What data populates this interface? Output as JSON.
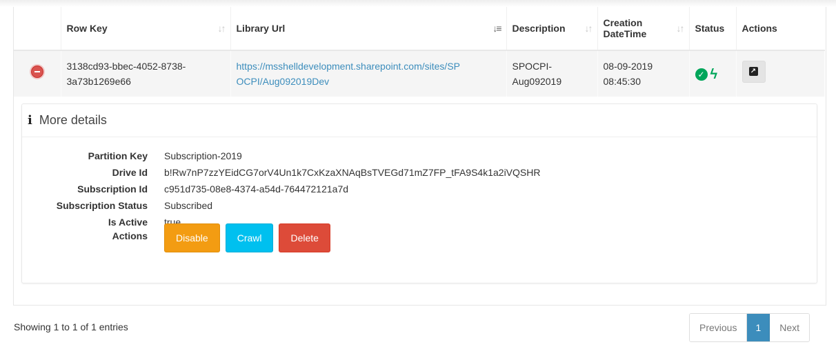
{
  "table": {
    "columns": [
      {
        "label": "",
        "key": "remove"
      },
      {
        "label": "Row Key",
        "key": "row_key",
        "sort": "unsorted"
      },
      {
        "label": "Library Url",
        "key": "library_url",
        "sort": "sorted"
      },
      {
        "label": "Description",
        "key": "description",
        "sort": "unsorted"
      },
      {
        "label_line1": "Creation",
        "label_line2": "DateTime",
        "key": "creation",
        "sort": "unsorted"
      },
      {
        "label": "Status",
        "key": "status"
      },
      {
        "label": "Actions",
        "key": "actions"
      }
    ],
    "rows": [
      {
        "row_key_l1": "3138cd93-bbec-4052-8738-",
        "row_key_l2": "3a73b1269e66",
        "library_url_l1": "https://msshelldevelopment.sharepoint.com/sites/SP",
        "library_url_l2": "OCPI/Aug092019Dev",
        "description_l1": "SPOCPI-",
        "description_l2": "Aug092019",
        "creation_l1": "08-09-2019",
        "creation_l2": "08:45:30",
        "status_icons": [
          "check-circle-icon",
          "bolt-icon"
        ],
        "action_icon": "external-link-icon"
      }
    ]
  },
  "details": {
    "title": "More details",
    "fields": [
      {
        "key": "Partition Key",
        "value": "Subscription-2019"
      },
      {
        "key": "Drive Id",
        "value": "b!Rw7nP7zzYEidCG7orV4Un1k7CxKzaXNAqBsTVEGd71mZ7FP_tFA9S4k1a2iVQSHR"
      },
      {
        "key": "Subscription Id",
        "value": "c951d735-08e8-4374-a54d-764472121a7d"
      },
      {
        "key": "Subscription Status",
        "value": "Subscribed"
      },
      {
        "key": "Is Active",
        "value": "true"
      }
    ],
    "actions_label": "Actions",
    "buttons": {
      "disable": "Disable",
      "crawl": "Crawl",
      "delete": "Delete"
    }
  },
  "footer": {
    "info": "Showing 1 to 1 of 1 entries",
    "pager": {
      "previous": "Previous",
      "current": "1",
      "next": "Next"
    }
  },
  "colors": {
    "link": "#3c8dbc",
    "success": "#00a65a",
    "warning": "#f39c12",
    "info": "#00c0ef",
    "danger": "#dd4b39",
    "pager_active": "#3c8dbc"
  }
}
